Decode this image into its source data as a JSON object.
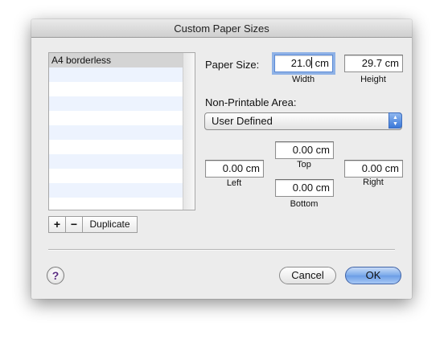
{
  "dialog": {
    "title": "Custom Paper Sizes"
  },
  "list": {
    "items": [
      "A4 borderless",
      "",
      "",
      "",
      "",
      "",
      "",
      "",
      "",
      "",
      ""
    ]
  },
  "list_controls": {
    "add_label": "+",
    "remove_label": "−",
    "duplicate_label": "Duplicate"
  },
  "paper_size": {
    "label": "Paper Size:",
    "width_value": "21.0",
    "width_unit": "cm",
    "width_caption": "Width",
    "height_value": "29.7 cm",
    "height_caption": "Height"
  },
  "non_printable": {
    "label": "Non-Printable Area:",
    "selected": "User Defined",
    "top_value": "0.00 cm",
    "top_caption": "Top",
    "left_value": "0.00 cm",
    "left_caption": "Left",
    "right_value": "0.00 cm",
    "right_caption": "Right",
    "bottom_value": "0.00 cm",
    "bottom_caption": "Bottom"
  },
  "footer": {
    "help_label": "?",
    "cancel_label": "Cancel",
    "ok_label": "OK"
  },
  "colors": {
    "accent": "#6b9de6",
    "row_stripe": "#edf3fe",
    "selected_row": "#d4d4d4"
  }
}
